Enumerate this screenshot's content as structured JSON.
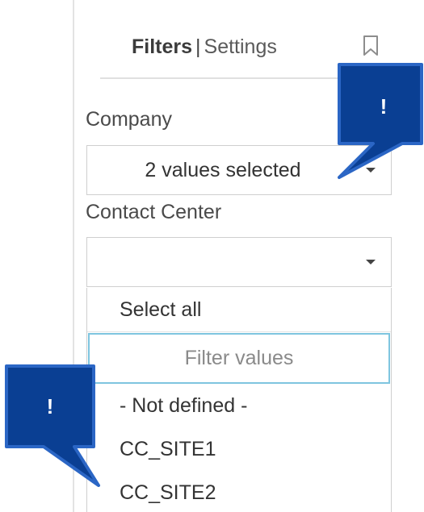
{
  "header": {
    "filters_tab": "Filters",
    "separator": "|",
    "settings_tab": "Settings",
    "bookmark_icon": "bookmark-icon"
  },
  "company": {
    "label": "Company",
    "value": "2 values selected"
  },
  "contact_center": {
    "label": "Contact Center",
    "value": "",
    "dropdown": {
      "select_all": "Select all",
      "filter_placeholder": "Filter values",
      "options": [
        "- Not defined -",
        "CC_SITE1",
        "CC_SITE2"
      ]
    }
  },
  "callouts": [
    {
      "text": "!",
      "icon": "exclamation-callout"
    },
    {
      "text": "!",
      "icon": "exclamation-callout"
    }
  ],
  "colors": {
    "callout_fill": "#0a3f93",
    "callout_border": "#2b66c5",
    "focus_border": "#7ec5df",
    "border": "#cfcfcf"
  }
}
